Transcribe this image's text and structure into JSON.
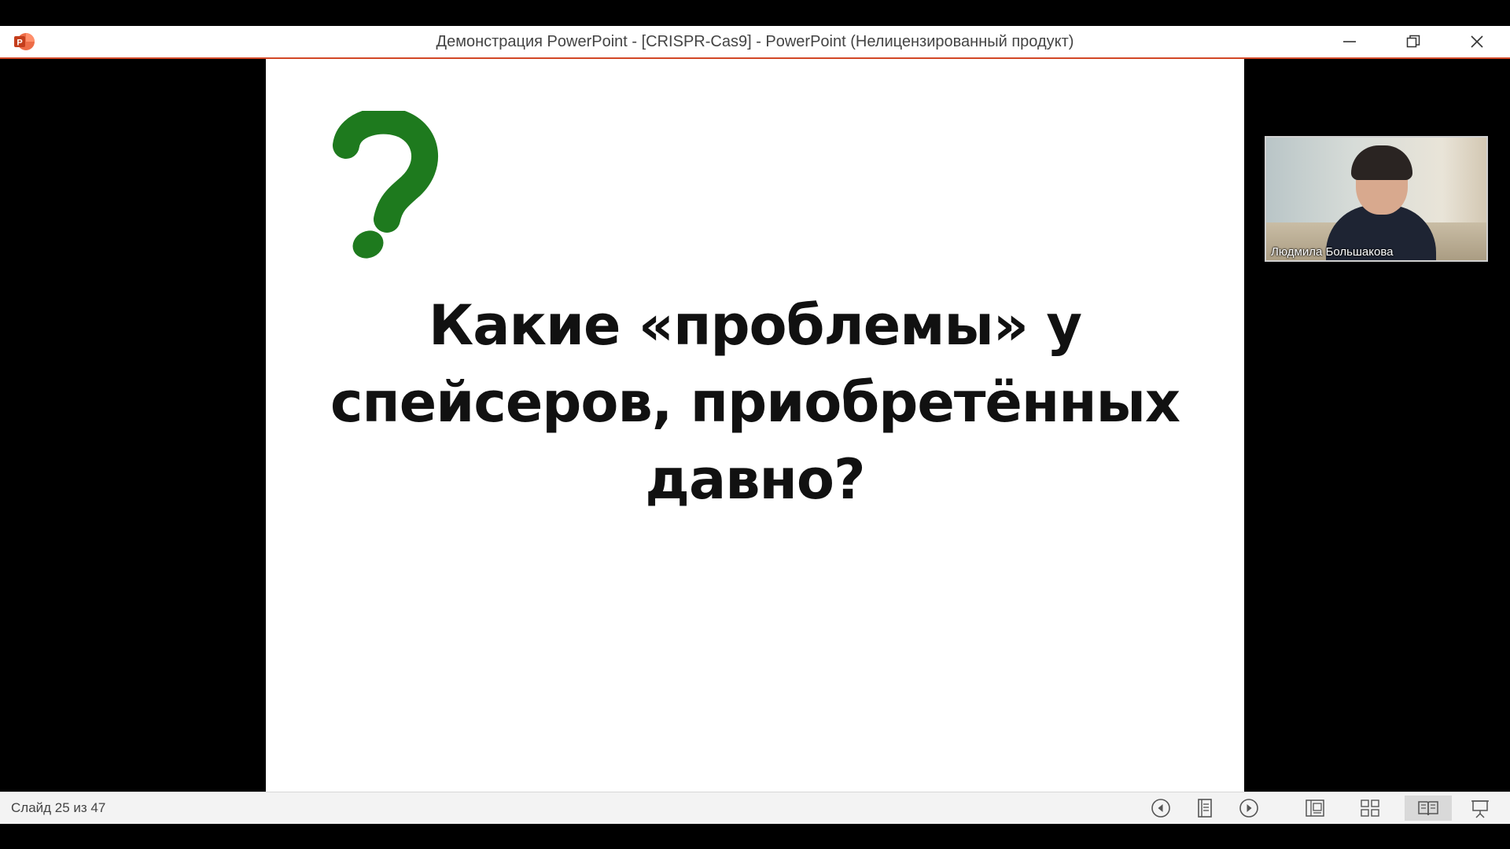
{
  "window": {
    "title": "Демонстрация PowerPoint - [CRISPR-Cas9] - PowerPoint (Нелицензированный продукт)",
    "app_icon": "powerpoint-icon",
    "controls": [
      "minimize-icon",
      "restore-icon",
      "close-icon"
    ],
    "accent_color": "#d24726"
  },
  "slide": {
    "icon": "question-mark-icon",
    "icon_color": "#1e7a1e",
    "title": "Какие «проблемы» у спейсеров, приобретённых давно?"
  },
  "video": {
    "participant_name": "Людмила Большакова"
  },
  "statusbar": {
    "slide_counter": "Слайд 25 из 47",
    "buttons": [
      "previous-icon",
      "notes-view-icon",
      "next-icon",
      "normal-view-icon",
      "slide-sorter-icon",
      "reading-view-icon",
      "slideshow-icon"
    ],
    "active_button": "reading-view-icon"
  }
}
